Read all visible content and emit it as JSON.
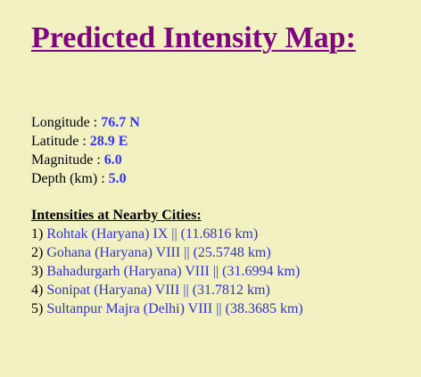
{
  "title": "Predicted Intensity Map:",
  "quake": {
    "longitude_label": "Longitude : ",
    "longitude_value": "76.7 N",
    "latitude_label": "Latitude : ",
    "latitude_value": "28.9 E",
    "magnitude_label": "Magnitude : ",
    "magnitude_value": "6.0",
    "depth_label": "Depth (km) : ",
    "depth_value": "5.0"
  },
  "cities": {
    "heading": "Intensities at Nearby Cities:",
    "items": [
      {
        "index": "1) ",
        "text": "Rohtak (Haryana) IX || (11.6816 km)"
      },
      {
        "index": "2) ",
        "text": "Gohana (Haryana) VIII || (25.5748 km)"
      },
      {
        "index": "3) ",
        "text": "Bahadurgarh (Haryana) VIII || (31.6994 km)"
      },
      {
        "index": "4) ",
        "text": "Sonipat (Haryana) VIII || (31.7812 km)"
      },
      {
        "index": "5) ",
        "text": "Sultanpur Majra (Delhi) VIII || (38.3685 km)"
      }
    ]
  },
  "colors": {
    "background": "#f2f1c2",
    "title": "#800080",
    "value": "#3333ff",
    "link": "#3333cc"
  }
}
